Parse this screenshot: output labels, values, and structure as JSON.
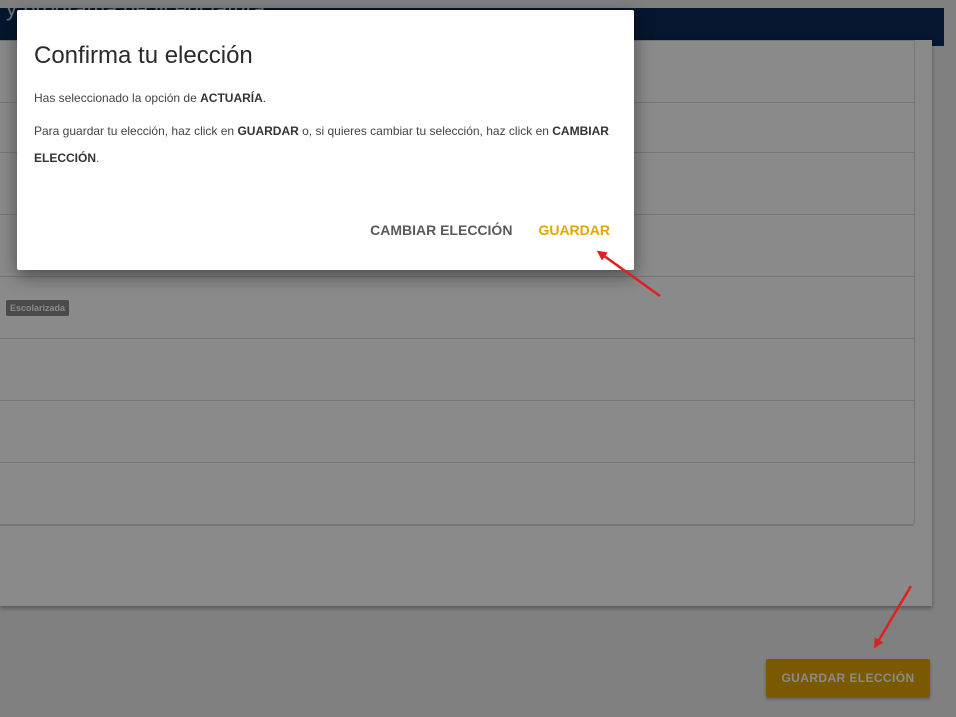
{
  "page": {
    "header_title": "y programa de licenciatura",
    "row_tag": "Escolarizada",
    "save_choice_button": "GUARDAR ELECCIÓN"
  },
  "dialog": {
    "title": "Confirma tu elección",
    "line1_pre": "Has seleccionado la opción de ",
    "selected_option": "ACTUARÍA",
    "line1_post": ".",
    "line2_pre": "Para guardar tu elección, haz click en ",
    "line2_guardar": "GUARDAR",
    "line2_mid": " o, si quieres cambiar tu selección, haz click en ",
    "line2_cambiar": "CAMBIAR ELECCIÓN",
    "line2_post": ".",
    "cambiar_button": "CAMBIAR ELECCIÓN",
    "guardar_button": "GUARDAR"
  },
  "colors": {
    "accent": "#e3a500",
    "header": "#0a2a55",
    "annotation_arrow": "#e02020"
  }
}
